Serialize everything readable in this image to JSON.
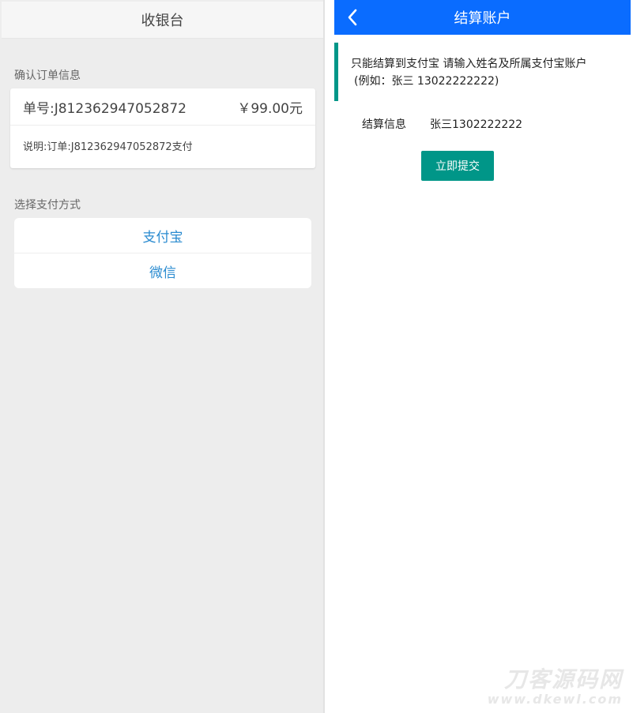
{
  "cashier": {
    "title": "收银台",
    "confirm_section_label": "确认订单信息",
    "order": {
      "number": "单号:J812362947052872",
      "amount": "￥99.00元",
      "description": "说明:订单:J812362947052872支付"
    },
    "payment_section_label": "选择支付方式",
    "payment_methods": [
      {
        "label": "支付宝"
      },
      {
        "label": "微信"
      }
    ]
  },
  "settlement": {
    "title": "结算账户",
    "back_icon": "chevron-left-icon",
    "notice_line1": "只能结算到支付宝 请输入姓名及所属支付宝账户",
    "notice_line2": "(例如：张三 13022222222)",
    "field_label": "结算信息",
    "field_value": "张三1302222222",
    "submit_label": "立即提交"
  },
  "watermark": {
    "title": "刀客源码网",
    "url": "www.dkewl.com"
  },
  "colors": {
    "header_blue": "#0a6cff",
    "accent_teal": "#009688",
    "link_blue": "#2a8bd0",
    "left_bg": "#ededed"
  }
}
